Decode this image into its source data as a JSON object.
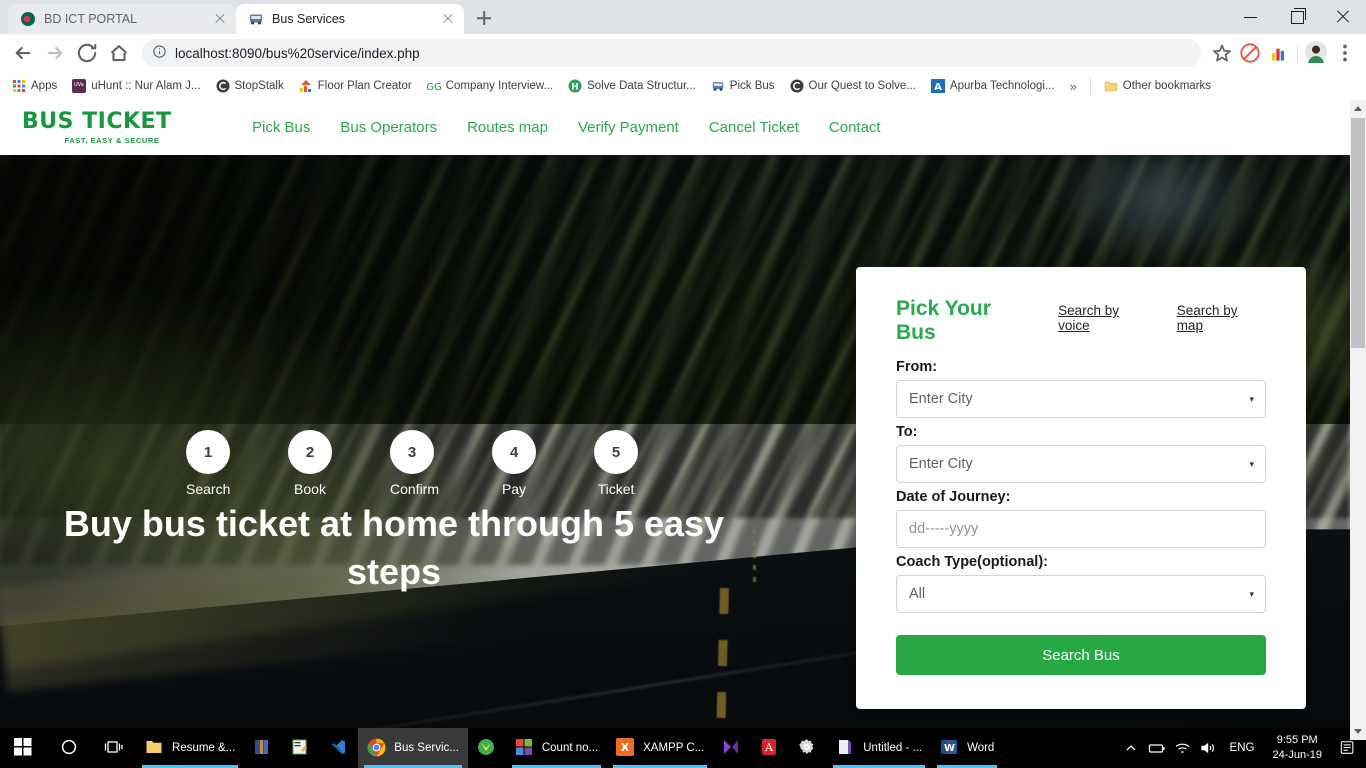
{
  "browser": {
    "tabs": [
      {
        "title": "BD ICT PORTAL",
        "favicon": "bd-flag-icon",
        "active": false
      },
      {
        "title": "Bus Services",
        "favicon": "bus-icon",
        "active": true
      }
    ],
    "new_tab_label": "+",
    "window_controls": {
      "minimize": "minimize-icon",
      "maximize": "maximize-icon",
      "close": "close-icon"
    },
    "toolbar": {
      "back": "back-arrow-icon",
      "forward": "forward-arrow-icon",
      "reload": "reload-icon",
      "home": "home-icon",
      "info": "info-icon",
      "url": "localhost:8090/bus%20service/index.php",
      "bookmark_star": "star-icon",
      "extension_adblock": "adblock-icon",
      "extension_chart": "chart-extension-icon",
      "profile": "avatar-icon",
      "menu": "three-dot-menu-icon"
    },
    "bookmarks": [
      {
        "label": "Apps",
        "icon": "apps-grid-icon"
      },
      {
        "label": "uHunt :: Nur Alam J...",
        "icon": "uva-icon"
      },
      {
        "label": "StopStalk",
        "icon": "stopstalk-icon"
      },
      {
        "label": "Floor Plan Creator",
        "icon": "floorplan-icon"
      },
      {
        "label": "Company Interview...",
        "icon": "geeks-icon"
      },
      {
        "label": "Solve Data Structur...",
        "icon": "hackerearth-icon"
      },
      {
        "label": "Pick Bus",
        "icon": "bus-icon"
      },
      {
        "label": "Our Quest to Solve...",
        "icon": "stopstalk-icon"
      },
      {
        "label": "Apurba Technologi...",
        "icon": "apurba-icon"
      }
    ],
    "bookmarks_overflow": "»",
    "other_bookmarks": {
      "label": "Other bookmarks",
      "icon": "folder-icon"
    }
  },
  "site": {
    "logo": {
      "main": "BUS TICKET",
      "tagline": "FAST, EASY & SECURE"
    },
    "nav": [
      {
        "label": "Pick Bus"
      },
      {
        "label": "Bus Operators"
      },
      {
        "label": "Routes map"
      },
      {
        "label": "Verify Payment"
      },
      {
        "label": "Cancel Ticket"
      },
      {
        "label": "Contact"
      }
    ],
    "hero": {
      "title": "Buy bus ticket at home through 5 easy steps",
      "steps": [
        {
          "number": "1",
          "label": "Search"
        },
        {
          "number": "2",
          "label": "Book"
        },
        {
          "number": "3",
          "label": "Confirm"
        },
        {
          "number": "4",
          "label": "Pay"
        },
        {
          "number": "5",
          "label": "Ticket"
        }
      ]
    },
    "booking": {
      "title": "Pick Your Bus",
      "link_voice": "Search by voice",
      "link_map": "Search by map",
      "from_label": "From:",
      "from_value": "Enter City",
      "to_label": "To:",
      "to_value": "Enter City",
      "date_label": "Date of Journey:",
      "date_placeholder": "dd-----yyyy",
      "coach_label": "Coach Type(optional):",
      "coach_value": "All",
      "submit_label": "Search Bus",
      "caret": "▾"
    },
    "colors": {
      "brand_green": "#2aa94f",
      "logo_green": "#1a9641",
      "button_green": "#28a745"
    }
  },
  "taskbar": {
    "start": "windows-start-icon",
    "search": "search-circle-icon",
    "taskview": "task-view-icon",
    "items": [
      {
        "label": "Resume &...",
        "icon": "folder-icon",
        "active": false,
        "running": true
      },
      {
        "label": "",
        "icon": "books-icon",
        "active": false,
        "running": false
      },
      {
        "label": "",
        "icon": "notepad-icon",
        "active": false,
        "running": false
      },
      {
        "label": "",
        "icon": "vscode-icon",
        "active": false,
        "running": false
      },
      {
        "label": "Bus Servic...",
        "icon": "chrome-icon",
        "active": true,
        "running": true
      },
      {
        "label": "",
        "icon": "yandex-icon",
        "active": false,
        "running": false
      },
      {
        "label": "Count no...",
        "icon": "windows-app-icon",
        "active": false,
        "running": true
      },
      {
        "label": "XAMPP C...",
        "icon": "xampp-icon",
        "active": false,
        "running": true
      },
      {
        "label": "",
        "icon": "media-icon",
        "active": false,
        "running": false
      },
      {
        "label": "",
        "icon": "acrobat-icon",
        "active": false,
        "running": false
      },
      {
        "label": "",
        "icon": "settings-gear-icon",
        "active": false,
        "running": false
      },
      {
        "label": "Untitled - ...",
        "icon": "onenote-icon",
        "active": false,
        "running": true
      },
      {
        "label": "Word",
        "icon": "word-icon",
        "active": false,
        "running": true
      }
    ],
    "tray": {
      "chevron": "show-hidden-icons-icon",
      "battery": "battery-icon",
      "wifi": "wifi-icon",
      "volume": "volume-icon",
      "language": "ENG",
      "time": "9:55 PM",
      "date": "24-Jun-19",
      "notifications": "action-center-icon"
    }
  }
}
